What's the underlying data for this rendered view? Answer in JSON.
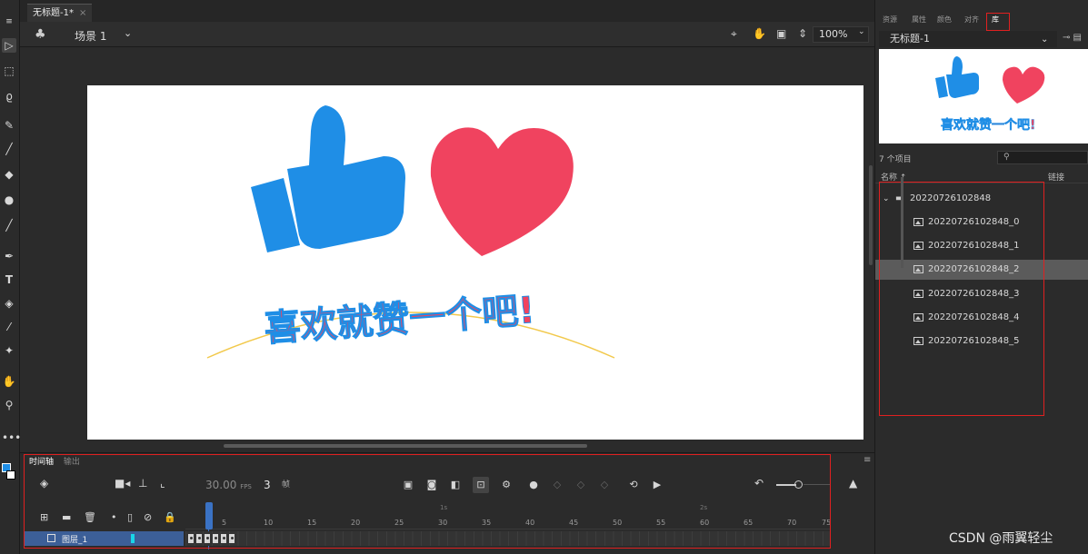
{
  "document": {
    "tab_title": "无标题-1*",
    "tab_close": "×"
  },
  "scene": {
    "icon": "scene-icon",
    "label": "场景 1",
    "zoom": "100%"
  },
  "stage": {
    "slogan": "喜欢就赞一个吧!",
    "colors": {
      "blue": "#1f8ee6",
      "red": "#f0435f",
      "arc": "#f2c94c"
    }
  },
  "right_panel": {
    "tabs": [
      "资源",
      "属性",
      "颜色",
      "对齐",
      "库"
    ],
    "active_tab": "库",
    "doc_select": "无标题-1",
    "item_count": "7 个项目",
    "search_placeholder": "",
    "col_name": "名称 ↑",
    "col_link": "链接",
    "folder": "20220726102848",
    "items": [
      "20220726102848_0",
      "20220726102848_1",
      "20220726102848_2",
      "20220726102848_3",
      "20220726102848_4",
      "20220726102848_5"
    ],
    "selected_index": 2
  },
  "timeline": {
    "tabs": [
      "时间轴",
      "输出"
    ],
    "fps": "30.00",
    "fps_unit": "FPS",
    "current_frame": "3",
    "frame_unit": "帧",
    "ruler_labels": [
      "5",
      "10",
      "15",
      "20",
      "25",
      "30",
      "35",
      "40",
      "45",
      "50",
      "55",
      "60",
      "65",
      "70",
      "75"
    ],
    "sec_labels": [
      "1s",
      "2s"
    ],
    "layer_name": "图层_1"
  },
  "watermark": "CSDN @雨翼轻尘"
}
